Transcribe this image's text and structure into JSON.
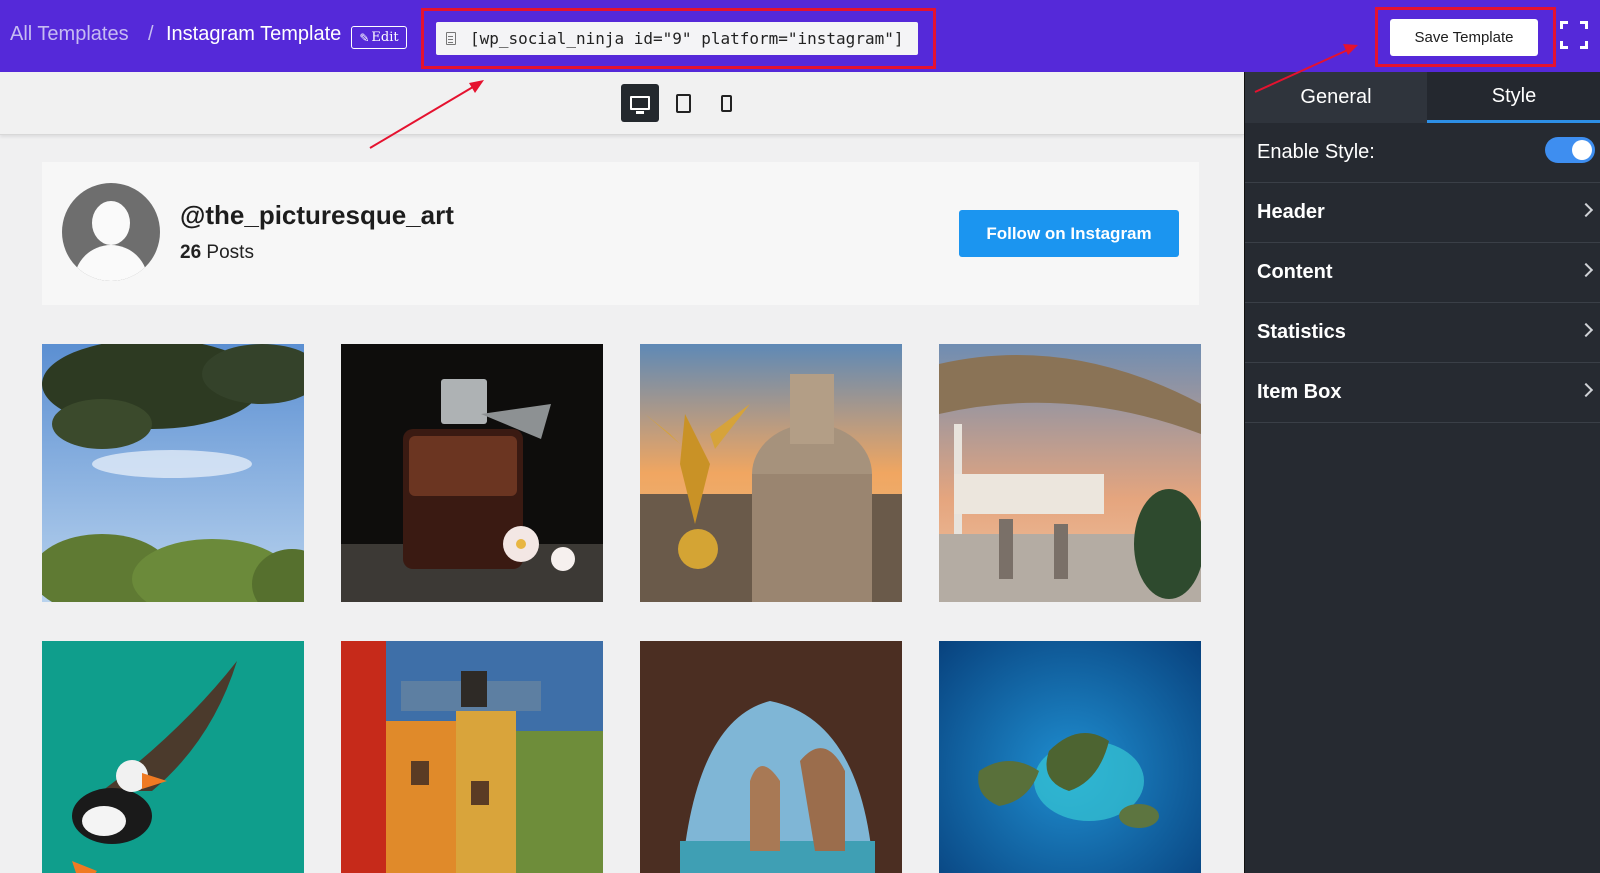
{
  "breadcrumb": {
    "all_templates": "All Templates",
    "separator": "/",
    "current": "Instagram Template",
    "edit_label": "Edit"
  },
  "shortcode": {
    "value": "[wp_social_ninja id=\"9\" platform=\"instagram\"]"
  },
  "toolbar": {
    "save_label": "Save Template"
  },
  "devices": [
    "desktop-icon",
    "tablet-icon",
    "mobile-icon"
  ],
  "profile": {
    "username": "@the_picturesque_art",
    "posts_count": "26",
    "posts_label": "Posts",
    "follow_label": "Follow on Instagram"
  },
  "feed": {
    "items": [
      {
        "subject": "tree-canopy"
      },
      {
        "subject": "perfume-bottle"
      },
      {
        "subject": "cathedral-dome"
      },
      {
        "subject": "beach-bar"
      },
      {
        "subject": "puffin"
      },
      {
        "subject": "colorful-street"
      },
      {
        "subject": "sea-cave"
      },
      {
        "subject": "island-aerial"
      }
    ]
  },
  "panel": {
    "tabs": {
      "general": "General",
      "style": "Style"
    },
    "enable_style_label": "Enable Style:",
    "enable_style_on": true,
    "sections": [
      "Header",
      "Content",
      "Statistics",
      "Item Box"
    ]
  },
  "colors": {
    "topbar": "#5529d9",
    "highlight": "#e5122f",
    "follow_button": "#1b95f0",
    "panel_bg": "#262a31",
    "tab_accent": "#2d8fe6"
  }
}
